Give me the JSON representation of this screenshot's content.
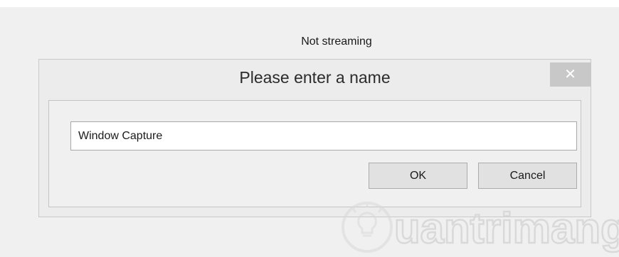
{
  "status": {
    "text": "Not streaming"
  },
  "dialog": {
    "title": "Please enter a name",
    "close_glyph": "✕",
    "input_value": "Window Capture",
    "ok_label": "OK",
    "cancel_label": "Cancel"
  },
  "watermark": {
    "text": "uantrimang"
  },
  "icons": {
    "close": "close-icon",
    "watermark_logo": "lightbulb-icon"
  }
}
